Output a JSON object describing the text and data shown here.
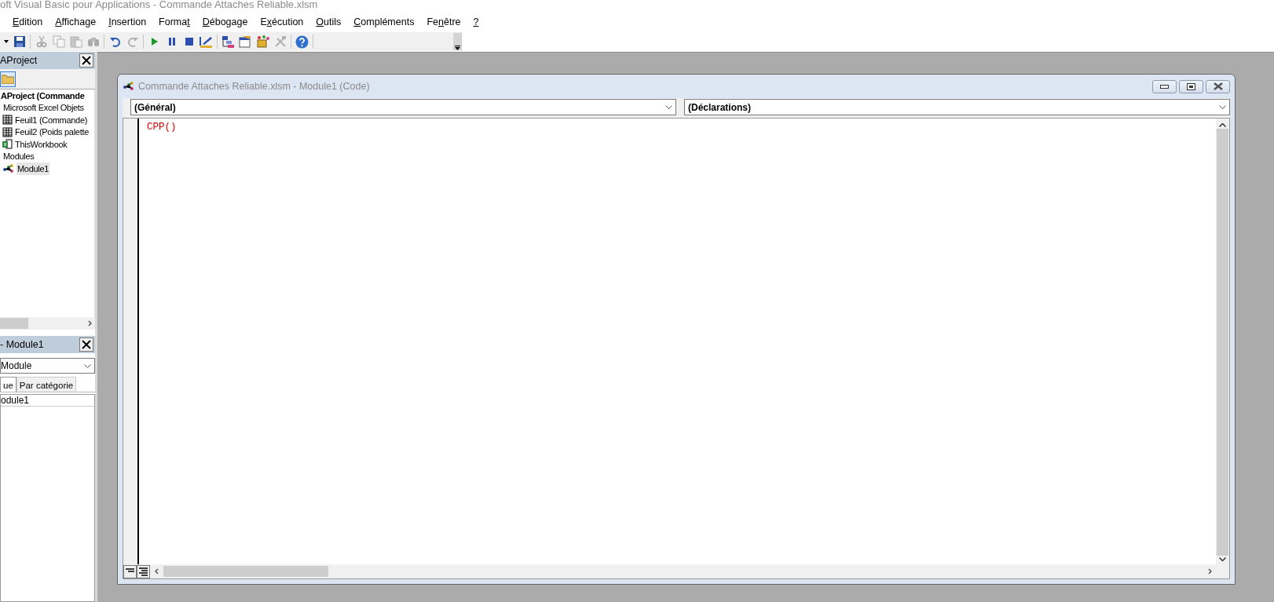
{
  "window": {
    "title": "oft Visual Basic pour Applications - Commande Attaches Reliable.xlsm"
  },
  "menu": [
    {
      "key": "E",
      "post": "dition"
    },
    {
      "key": "A",
      "post": "ffichage"
    },
    {
      "key": "I",
      "post": "nsertion"
    },
    {
      "pre": "Forma",
      "key": "t"
    },
    {
      "key": "D",
      "post": "ébogage"
    },
    {
      "pre": "E",
      "key": "x",
      "post": "écution"
    },
    {
      "key": "O",
      "post": "utils"
    },
    {
      "key": "C",
      "post": "ompléments"
    },
    {
      "pre": "Fe",
      "key": "n",
      "post": "être"
    },
    {
      "key": "?"
    }
  ],
  "toolbar": {
    "groups": [
      [
        {
          "kind": "dropdown",
          "disabled": false
        },
        {
          "kind": "save",
          "disabled": false
        }
      ],
      [
        {
          "kind": "cut",
          "disabled": true
        },
        {
          "kind": "copy",
          "disabled": true
        },
        {
          "kind": "paste",
          "disabled": true
        },
        {
          "kind": "find",
          "disabled": true
        }
      ],
      [
        {
          "kind": "undo",
          "disabled": false
        },
        {
          "kind": "redo",
          "disabled": true
        }
      ],
      [
        {
          "kind": "run",
          "disabled": false
        },
        {
          "kind": "pause",
          "disabled": false
        },
        {
          "kind": "stop",
          "disabled": false
        },
        {
          "kind": "design",
          "disabled": false
        }
      ],
      [
        {
          "kind": "project",
          "disabled": false
        },
        {
          "kind": "properties",
          "disabled": false
        },
        {
          "kind": "browser",
          "disabled": false
        },
        {
          "kind": "toolbox",
          "disabled": true
        }
      ],
      [
        {
          "kind": "help",
          "disabled": false
        }
      ]
    ]
  },
  "project_explorer": {
    "title": "AProject",
    "tree": [
      {
        "label": "AProject (Commande",
        "kind": "project",
        "selected": false,
        "children": [
          {
            "label": "Microsoft Excel Objets",
            "selected": false,
            "children": [
              {
                "label": "Feuil1 (Commande)",
                "kind": "sheet",
                "selected": false
              },
              {
                "label": "Feuil2 (Poids palette",
                "kind": "sheet",
                "selected": false
              },
              {
                "label": "ThisWorkbook",
                "kind": "workbook",
                "selected": false
              }
            ]
          },
          {
            "label": "Modules",
            "selected": false,
            "children": [
              {
                "label": "Module1",
                "kind": "module",
                "selected": true
              }
            ]
          }
        ]
      }
    ]
  },
  "properties": {
    "title": "- Module1",
    "object": "Module",
    "tabs": [
      {
        "label": "ue",
        "selected": true
      },
      {
        "label": "Par catégorie",
        "selected": false
      }
    ],
    "rows": [
      {
        "value": "odule1"
      }
    ]
  },
  "code_window": {
    "title": "Commande Attaches Reliable.xlsm - Module1 (Code)",
    "object": "(Général)",
    "procedure": "(Déclarations)",
    "lines": [
      {
        "text": "CPP()",
        "error": true
      }
    ]
  }
}
